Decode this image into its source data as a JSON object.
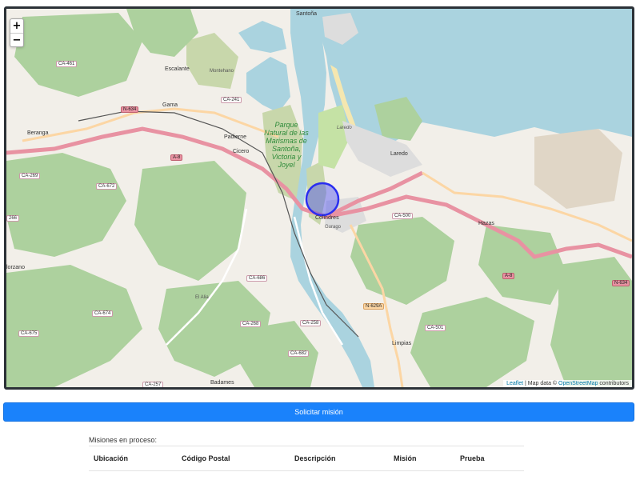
{
  "map": {
    "zoom_in": "+",
    "zoom_out": "−",
    "attribution": {
      "leaflet": "Leaflet",
      "separator": " | Map data © ",
      "osm": "OpenStreetMap",
      "suffix": " contributors"
    },
    "colors": {
      "water": "#aad3df",
      "land": "#f2efe9",
      "forest": "#add19e",
      "marsh": "#c8d7ab",
      "motorway": "#e892a2",
      "primary": "#fcd6a4",
      "marker_fill": "#4b50f0",
      "marker_stroke": "#2a2ef0"
    },
    "places": {
      "santona": "Santoña",
      "escalante": "Escalante",
      "gama": "Gama",
      "beranga": "Beranga",
      "padierne": "Padierne",
      "cicero": "Cicero",
      "laredo": "Laredo",
      "laredo_small": "Laredo",
      "colindres": "Colindres",
      "hazas": "Hazas",
      "limpias": "Limpias",
      "badames": "Badames",
      "rozano": "lorzano",
      "el_alia": "El Alia",
      "montehano": "Montehano",
      "gibaja": "Gurago",
      "marismas_park": "Parque Natural de las Marismas de Santoña, Victoria y Joyel"
    },
    "roads": [
      "N-634",
      "CA-241",
      "A-8",
      "CA-461",
      "CA-269",
      "CA-672",
      "CA-686",
      "CA-674",
      "CA-675",
      "CA-268",
      "CA-258",
      "CA-682",
      "CA-500",
      "CA-501",
      "N-629A",
      "A-8",
      "N-634",
      "CA-257",
      "266"
    ]
  },
  "actions": {
    "request_mission": "Solicitar misión"
  },
  "missions": {
    "caption": "Misiones en proceso:",
    "columns": [
      "Ubicación",
      "Código Postal",
      "Descripción",
      "Misión",
      "Prueba"
    ]
  }
}
